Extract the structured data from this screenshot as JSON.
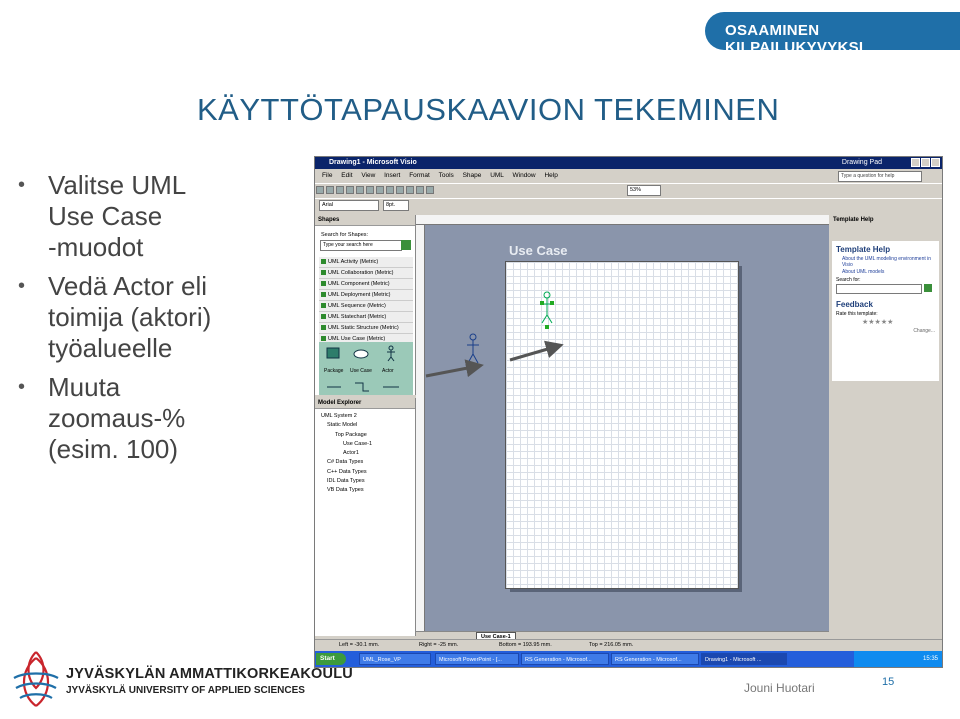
{
  "banner": {
    "text": "OSAAMINEN KILPAILUKYVYKSI"
  },
  "slide": {
    "title": "KÄYTTÖTAPAUSKAAVION TEKEMINEN",
    "bullets": [
      [
        "Valitse UML",
        "Use Case",
        "-muodot"
      ],
      [
        "Vedä Actor eli",
        "toimija (aktori)",
        "työalueelle"
      ],
      [
        "Muuta",
        "zoomaus-%",
        "(esim. 100)"
      ]
    ]
  },
  "visio": {
    "title": "Drawing1 - Microsoft Visio",
    "drawing_pad": "Drawing Pad",
    "menu": [
      "File",
      "Edit",
      "View",
      "Insert",
      "Format",
      "Tools",
      "Shape",
      "UML",
      "Window",
      "Help"
    ],
    "ask_placeholder": "Type a question for help",
    "font": "Arial",
    "font_size": "8pt.",
    "zoom": "53%",
    "shapes_pane": {
      "title": "Shapes",
      "search_label": "Search for Shapes:",
      "search_placeholder": "Type your search here",
      "stencils": [
        "UML Activity (Metric)",
        "UML Collaboration (Metric)",
        "UML Component (Metric)",
        "UML Deployment (Metric)",
        "UML Sequence (Metric)",
        "UML Statechart (Metric)",
        "UML Static Structure (Metric)",
        "UML Use Case (Metric)"
      ],
      "palette": [
        "Package",
        "Use Case",
        "Actor"
      ]
    },
    "model_explorer": {
      "title": "Model Explorer",
      "tree": [
        "UML System 2",
        "Static Model",
        "Top Package",
        "Use Case-1",
        "Actor1",
        "C# Data Types",
        "C++ Data Types",
        "IDL Data Types",
        "VB Data Types"
      ]
    },
    "canvas_label": "Use Case",
    "template_help": {
      "title": "Template Help",
      "heading": "Template Help",
      "links": [
        "About the UML modeling environment in Visio",
        "About UML models"
      ],
      "search_label": "Search for:",
      "feedback": "Feedback",
      "rate": "Rate this template:",
      "change": "Change..."
    },
    "page_tab": "Use Case-1",
    "status": {
      "left": "Left = -30.1 mm.",
      "right": "Right = -25 mm.",
      "bottom": "Bottom = 193.95 mm.",
      "top": "Top = 216.05 mm."
    },
    "taskbar": {
      "start": "Start",
      "tasks": [
        "UML_Rose_VP",
        "Microsoft PowerPoint - [...",
        "RS Generation - Microsof...",
        "RS Generation - Microsof...",
        "Drawing1 - Microsoft ..."
      ],
      "clock": "15:35"
    }
  },
  "footer": {
    "logo_line1": "JYVÄSKYLÄN AMMATTIKORKEAKOULU",
    "logo_line2": "JYVÄSKYLÄ UNIVERSITY OF APPLIED SCIENCES",
    "author": "Jouni Huotari",
    "page_number": "15"
  },
  "colors": {
    "brand_blue": "#1f6fa8",
    "title_blue": "#215d87"
  }
}
